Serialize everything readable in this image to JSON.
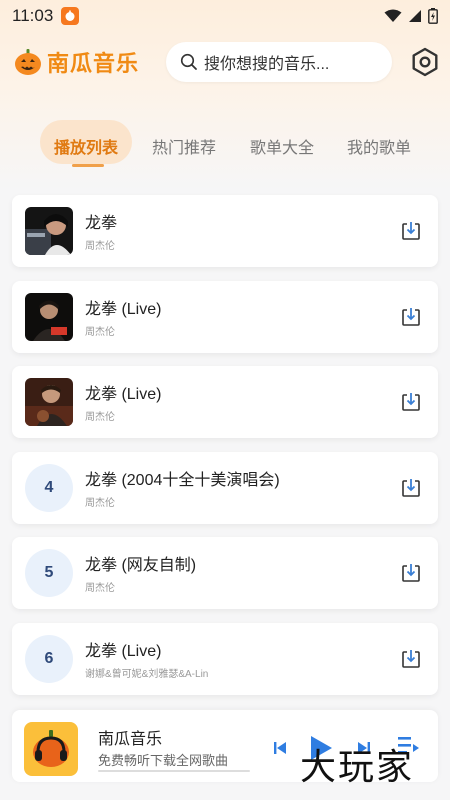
{
  "status_bar": {
    "time": "11:03"
  },
  "header": {
    "app_title": "南瓜音乐",
    "search_placeholder": "搜你想搜的音乐..."
  },
  "tabs": [
    {
      "label": "播放列表",
      "active": true
    },
    {
      "label": "热门推荐",
      "active": false
    },
    {
      "label": "歌单大全",
      "active": false
    },
    {
      "label": "我的歌单",
      "active": false
    }
  ],
  "songs": [
    {
      "title": "龙拳",
      "artist": "周杰伦",
      "cover": "image"
    },
    {
      "title": "龙拳 (Live)",
      "artist": "周杰伦",
      "cover": "image"
    },
    {
      "title": "龙拳 (Live)",
      "artist": "周杰伦",
      "cover": "image"
    },
    {
      "title": "龙拳 (2004十全十美演唱会)",
      "artist": "周杰伦",
      "index": "4"
    },
    {
      "title": "龙拳 (网友自制)",
      "artist": "周杰伦",
      "index": "5"
    },
    {
      "title": "龙拳 (Live)",
      "artist": "谢娜&曾可妮&刘雅瑟&A-Lin",
      "index": "6"
    }
  ],
  "player": {
    "title": "南瓜音乐",
    "subtitle": "免费畅听下载全网歌曲",
    "progress": 0
  },
  "watermark": "大玩家",
  "colors": {
    "accent": "#f08a14",
    "tab_active_bg": "#fbe4cc",
    "control_blue": "#2f7de1"
  }
}
